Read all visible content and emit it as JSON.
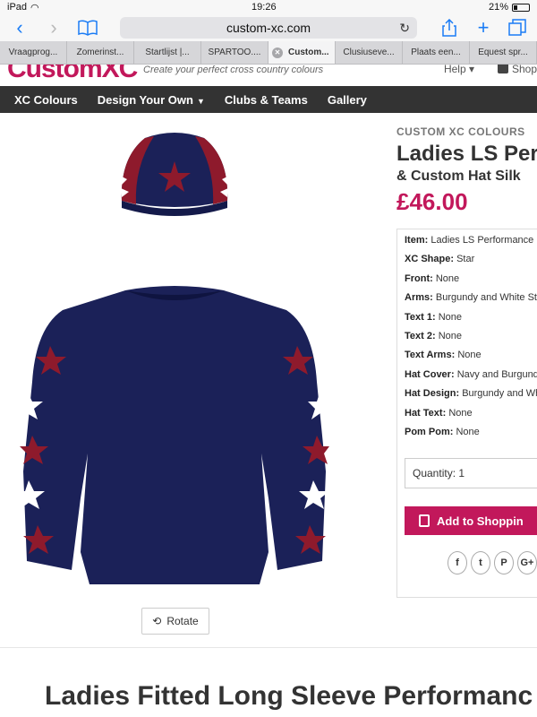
{
  "status": {
    "device": "iPad",
    "time": "19:26",
    "battery": "21%"
  },
  "browser": {
    "url": "custom-xc.com",
    "tabs": [
      "Vraagprog...",
      "Zomerinst...",
      "Startlijst |...",
      "SPARTOO....",
      "Custom...",
      "Clusiuseve...",
      "Plaats een...",
      "Equest spr..."
    ],
    "active_tab_index": 4
  },
  "site": {
    "logo": "CustomXC",
    "tagline": "Create your perfect cross country colours",
    "help": "Help",
    "shop": "Shop",
    "nav": [
      "XC Colours",
      "Design Your Own",
      "Clubs & Teams",
      "Gallery"
    ]
  },
  "product": {
    "kicker": "CUSTOM XC COLOURS",
    "title": "Ladies LS Performance",
    "subtitle": "& Custom Hat Silk",
    "price": "£46.00",
    "details": [
      {
        "label": "Item:",
        "value": "Ladies LS Performance"
      },
      {
        "label": "XC Shape:",
        "value": "Star"
      },
      {
        "label": "Front:",
        "value": "None"
      },
      {
        "label": "Arms:",
        "value": "Burgundy and White St"
      },
      {
        "label": "Text 1:",
        "value": "None"
      },
      {
        "label": "Text 2:",
        "value": "None"
      },
      {
        "label": "Text Arms:",
        "value": "None"
      },
      {
        "label": "Hat Cover:",
        "value": "Navy and Burgund"
      },
      {
        "label": "Hat Design:",
        "value": "Burgundy and Wh"
      },
      {
        "label": "Hat Text:",
        "value": "None"
      },
      {
        "label": "Pom Pom:",
        "value": "None"
      }
    ],
    "quantity": "Quantity: 1",
    "add_to_cart": "Add to Shoppin",
    "rotate": "Rotate",
    "social": [
      "f",
      "t",
      "P",
      "G+"
    ],
    "big_title": "Ladies Fitted Long Sleeve Performanc"
  },
  "colors": {
    "navy": "#1b2158",
    "burgundy": "#8e1a2c",
    "pink": "#c2185b",
    "nav_bg": "#333333"
  }
}
